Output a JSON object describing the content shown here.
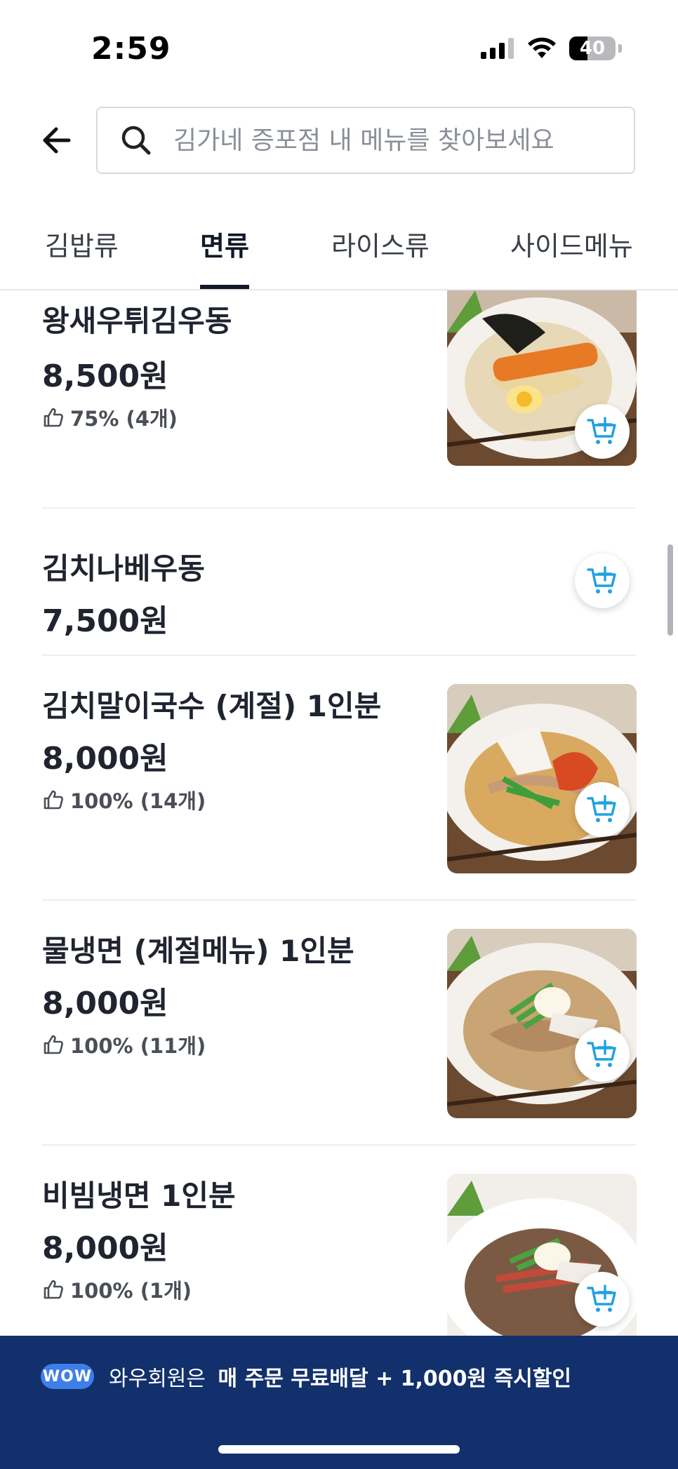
{
  "status_bar": {
    "time": "2:59",
    "battery": "40",
    "battery_level": 0.4
  },
  "search": {
    "placeholder": "김가네 증포점 내 메뉴를 찾아보세요"
  },
  "tabs": [
    {
      "label": "김밥류",
      "active": false
    },
    {
      "label": "면류",
      "active": true
    },
    {
      "label": "라이스류",
      "active": false
    },
    {
      "label": "사이드메뉴",
      "active": false
    }
  ],
  "menu_items": [
    {
      "name": "왕새우튀김우동",
      "price": "8,500원",
      "rating": "75% (4개)",
      "has_photo": true
    },
    {
      "name": "김치나베우동",
      "price": "7,500원",
      "rating": "",
      "has_photo": false
    },
    {
      "name": "김치말이국수 (계절) 1인분",
      "price": "8,000원",
      "rating": "100% (14개)",
      "has_photo": true
    },
    {
      "name": "물냉면 (계절메뉴) 1인분",
      "price": "8,000원",
      "rating": "100% (11개)",
      "has_photo": true
    },
    {
      "name": "비빔냉면 1인분",
      "price": "8,000원",
      "rating": "100% (1개)",
      "has_photo": true
    }
  ],
  "wow_banner": {
    "badge": "WOW",
    "text_prefix": "와우회원은",
    "text_bold": "매 주문 무료배달 + 1,000원 즉시할인"
  },
  "colors": {
    "accent": "#12306b",
    "cart_icon": "#1ea1e0",
    "badge": "#3e7ee8"
  },
  "icons": {
    "back": "arrow-left-icon",
    "search": "search-icon",
    "thumb": "thumbs-up-icon",
    "cart": "cart-add-icon"
  }
}
